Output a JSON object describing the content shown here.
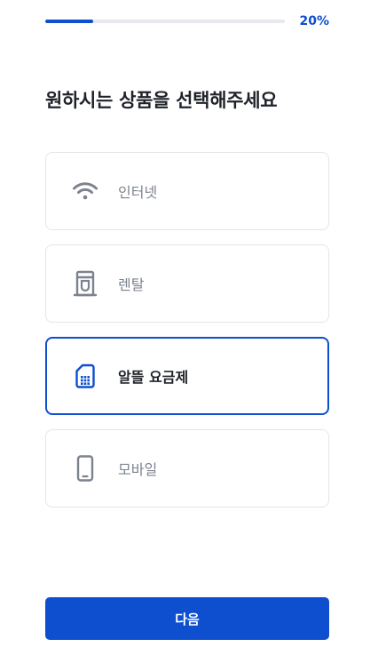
{
  "progress": {
    "value": 0.2,
    "label": "20%"
  },
  "title": "원하시는 상품을 선택해주세요",
  "options": [
    {
      "label": "인터넷",
      "icon": "wifi-icon",
      "selected": false
    },
    {
      "label": "렌탈",
      "icon": "water-purifier-icon",
      "selected": false
    },
    {
      "label": "알뜰 요금제",
      "icon": "sim-card-icon",
      "selected": true
    },
    {
      "label": "모바일",
      "icon": "mobile-phone-icon",
      "selected": false
    }
  ],
  "next_button": {
    "label": "다음"
  },
  "colors": {
    "accent": "#0d4fcf",
    "icon_inactive": "#7c838e",
    "border": "#e3e6ea",
    "track": "#e7e9ee"
  }
}
